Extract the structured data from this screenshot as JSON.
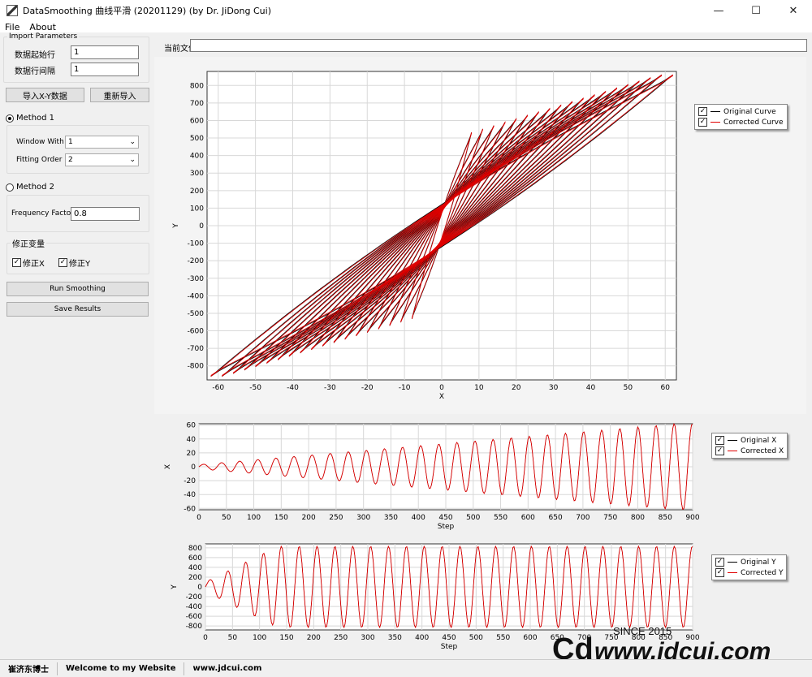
{
  "window": {
    "title": "DataSmoothing 曲线平滑 (20201129) (by Dr. JiDong Cui)",
    "minimize": "—",
    "maximize": "☐",
    "close": "✕"
  },
  "menu": [
    {
      "label": "File"
    },
    {
      "label": "About"
    }
  ],
  "import": {
    "legend": "Import Parameters",
    "start_row_label": "数据起始行",
    "start_row_value": "1",
    "row_interval_label": "数据行间隔",
    "row_interval_value": "1",
    "import_button": "导入X-Y数据",
    "reimport_button": "重新导入"
  },
  "method1": {
    "label": "Method 1",
    "selected": true,
    "window_label": "Window With",
    "window_value": "1",
    "order_label": "Fitting Order",
    "order_value": "2"
  },
  "method2": {
    "label": "Method 2",
    "selected": false,
    "freq_label": "Frequency Factor",
    "freq_value": "0.8"
  },
  "correct": {
    "legend": "修正变量",
    "x_label": "修正X",
    "y_label": "修正Y"
  },
  "actions": {
    "run": "Run Smoothing",
    "save": "Save Results"
  },
  "file": {
    "label": "当前文件",
    "value": ""
  },
  "colors": {
    "original": "#000000",
    "corrected": "#e00000"
  },
  "chart_data": [
    {
      "type": "line",
      "xlabel": "X",
      "ylabel": "Y",
      "xlim": [
        -63,
        63
      ],
      "ylim": [
        -880,
        880
      ],
      "xticks": [
        -60,
        -50,
        -40,
        -30,
        -20,
        -10,
        0,
        10,
        20,
        30,
        40,
        50,
        60
      ],
      "yticks": [
        800,
        700,
        600,
        500,
        400,
        300,
        200,
        100,
        0,
        -100,
        -200,
        -300,
        -400,
        -500,
        -600,
        -700,
        -800
      ],
      "grid": true,
      "legend_position": "top-right",
      "series": [
        {
          "name": "Original Curve"
        },
        {
          "name": "Corrected Curve"
        }
      ]
    },
    {
      "type": "line",
      "xlabel": "Step",
      "ylabel": "X",
      "xlim": [
        0,
        900
      ],
      "ylim": [
        -62,
        62
      ],
      "xticks": [
        0,
        50,
        100,
        150,
        200,
        250,
        300,
        350,
        400,
        450,
        500,
        550,
        600,
        650,
        700,
        750,
        800,
        850,
        900
      ],
      "yticks": [
        60,
        40,
        20,
        0,
        -20,
        -40,
        -60
      ],
      "grid": true,
      "legend_position": "top-right",
      "series": [
        {
          "name": "Original X"
        },
        {
          "name": "Corrected X"
        }
      ]
    },
    {
      "type": "line",
      "xlabel": "Step",
      "ylabel": "Y",
      "xlim": [
        0,
        900
      ],
      "ylim": [
        -880,
        880
      ],
      "xticks": [
        0,
        50,
        100,
        150,
        200,
        250,
        300,
        350,
        400,
        450,
        500,
        550,
        600,
        650,
        700,
        750,
        800,
        850,
        900
      ],
      "yticks": [
        800,
        600,
        400,
        200,
        0,
        -200,
        -400,
        -600,
        -800
      ],
      "grid": true,
      "legend_position": "top-right",
      "series": [
        {
          "name": "Original Y"
        },
        {
          "name": "Corrected Y"
        }
      ]
    }
  ],
  "status": {
    "author": "崔济东博士",
    "welcome": "Welcome to my Website",
    "site": "www.jdcui.com"
  },
  "watermark": {
    "since": "SINCE 2015",
    "site": "www.jdcui.com"
  }
}
